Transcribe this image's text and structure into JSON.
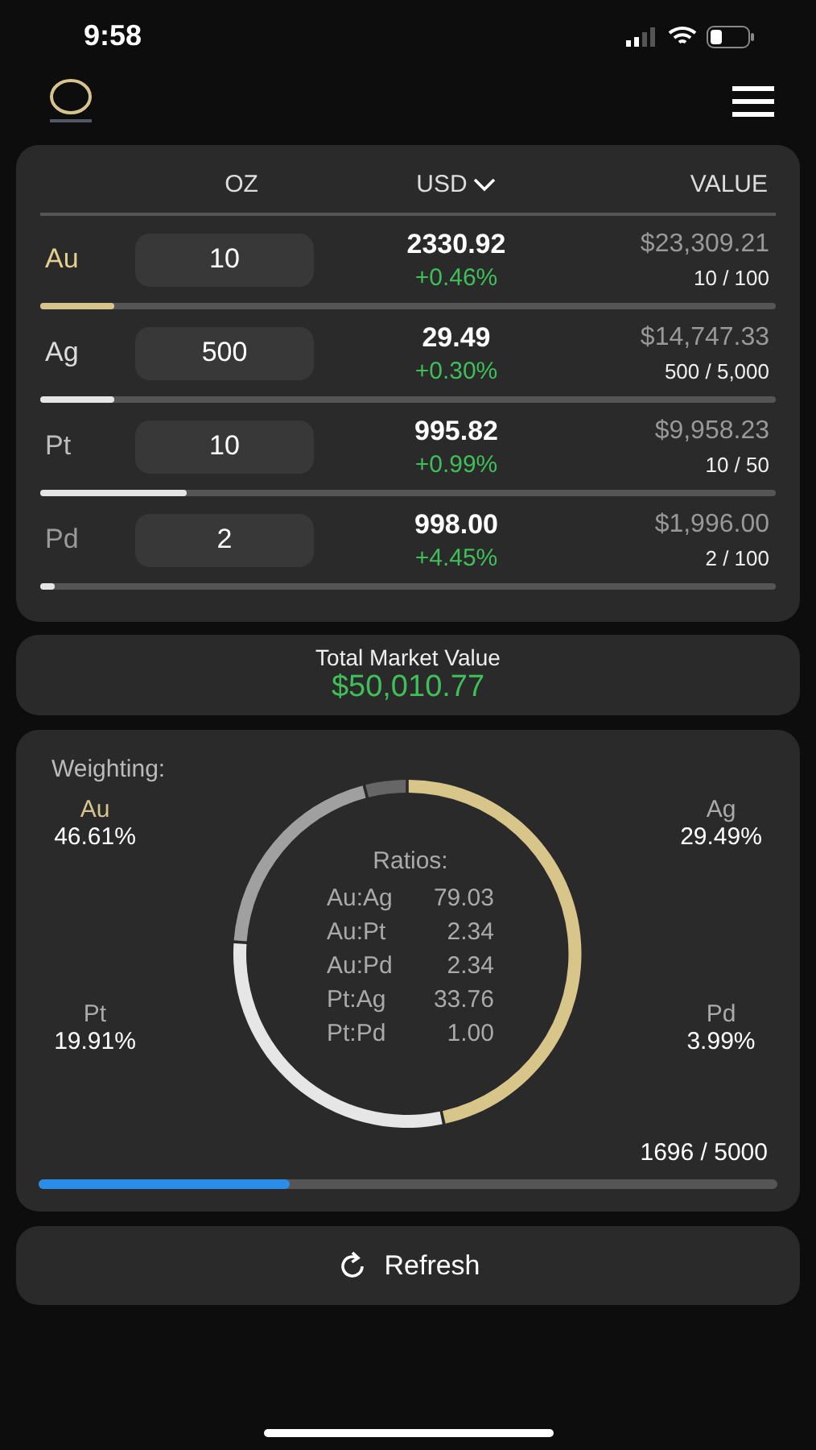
{
  "status_bar": {
    "time": "9:58"
  },
  "table": {
    "columns": [
      "OZ",
      "USD",
      "VALUE"
    ],
    "rows": [
      {
        "metal": "Au",
        "oz": "10",
        "price": "2330.92",
        "change": "+0.46%",
        "value": "$23,309.21",
        "holding": "10 / 100",
        "level": 0.1
      },
      {
        "metal": "Ag",
        "oz": "500",
        "price": "29.49",
        "change": "+0.30%",
        "value": "$14,747.33",
        "holding": "500 / 5,000",
        "level": 0.1
      },
      {
        "metal": "Pt",
        "oz": "10",
        "price": "995.82",
        "change": "+0.99%",
        "value": "$9,958.23",
        "holding": "10 / 50",
        "level": 0.2
      },
      {
        "metal": "Pd",
        "oz": "2",
        "price": "998.00",
        "change": "+4.45%",
        "value": "$1,996.00",
        "holding": "2 / 100",
        "level": 0.02
      }
    ]
  },
  "total": {
    "label": "Total Market Value",
    "value": "$50,010.77"
  },
  "weighting": {
    "title": "Weighting:",
    "items": [
      {
        "percent": "46.61%"
      },
      {
        "percent": "29.49%"
      },
      {
        "percent": "19.91%"
      },
      {
        "percent": "3.99%"
      }
    ],
    "chart_data": {
      "type": "donut",
      "categories": [
        "Au",
        "Ag",
        "Pt",
        "Pd"
      ],
      "values": [
        46.61,
        29.49,
        19.91,
        3.99
      ]
    },
    "ratios_title": "Ratios:",
    "ratios": [
      {
        "pair": "Au:Ag",
        "value": "79.03"
      },
      {
        "pair": "Au:Pt",
        "value": "2.34"
      },
      {
        "pair": "Au:Pd",
        "value": "2.34"
      },
      {
        "pair": "Pt:Ag",
        "value": "33.76"
      },
      {
        "pair": "Pt:Pd",
        "value": "1.00"
      }
    ],
    "usage": "1696 / 5000",
    "level": 0.34
  },
  "refresh_button": "Refresh"
}
